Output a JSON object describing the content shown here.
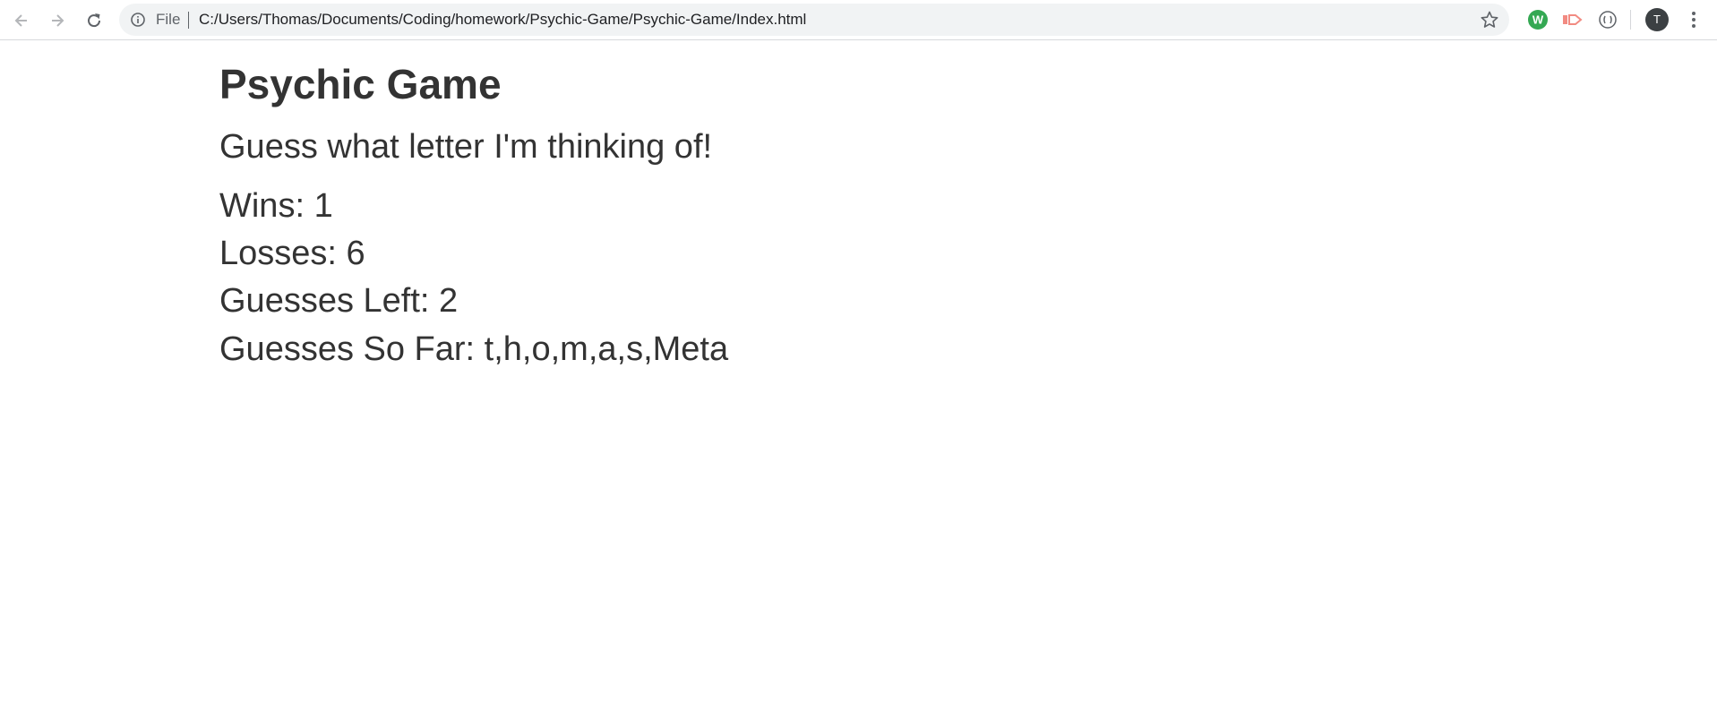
{
  "browser": {
    "scheme_label": "File",
    "url": "C:/Users/Thomas/Documents/Coding/homework/Psychic-Game/Psychic-Game/Index.html",
    "avatar_initial": "T",
    "extension_w_label": "W",
    "icons": [
      "back-arrow-icon",
      "forward-arrow-icon",
      "reload-icon",
      "info-icon",
      "star-icon",
      "w-extension-icon",
      "tag-extension-icon",
      "circle-extension-icon",
      "kebab-menu-icon"
    ],
    "colors": {
      "omnibox_bg": "#f1f3f4",
      "w_extension": "#34a853",
      "tag_extension": "#f28b82",
      "avatar_bg": "#3c4043"
    }
  },
  "game": {
    "title": "Psychic Game",
    "subtitle": "Guess what letter I'm thinking of!",
    "wins_label": "Wins: ",
    "wins": "1",
    "losses_label": "Losses: ",
    "losses": "6",
    "guesses_left_label": "Guesses Left: ",
    "guesses_left": "2",
    "guesses_so_far_label": "Guesses So Far: ",
    "guesses_so_far": "t,h,o,m,a,s,Meta",
    "text_color": "#333333"
  }
}
